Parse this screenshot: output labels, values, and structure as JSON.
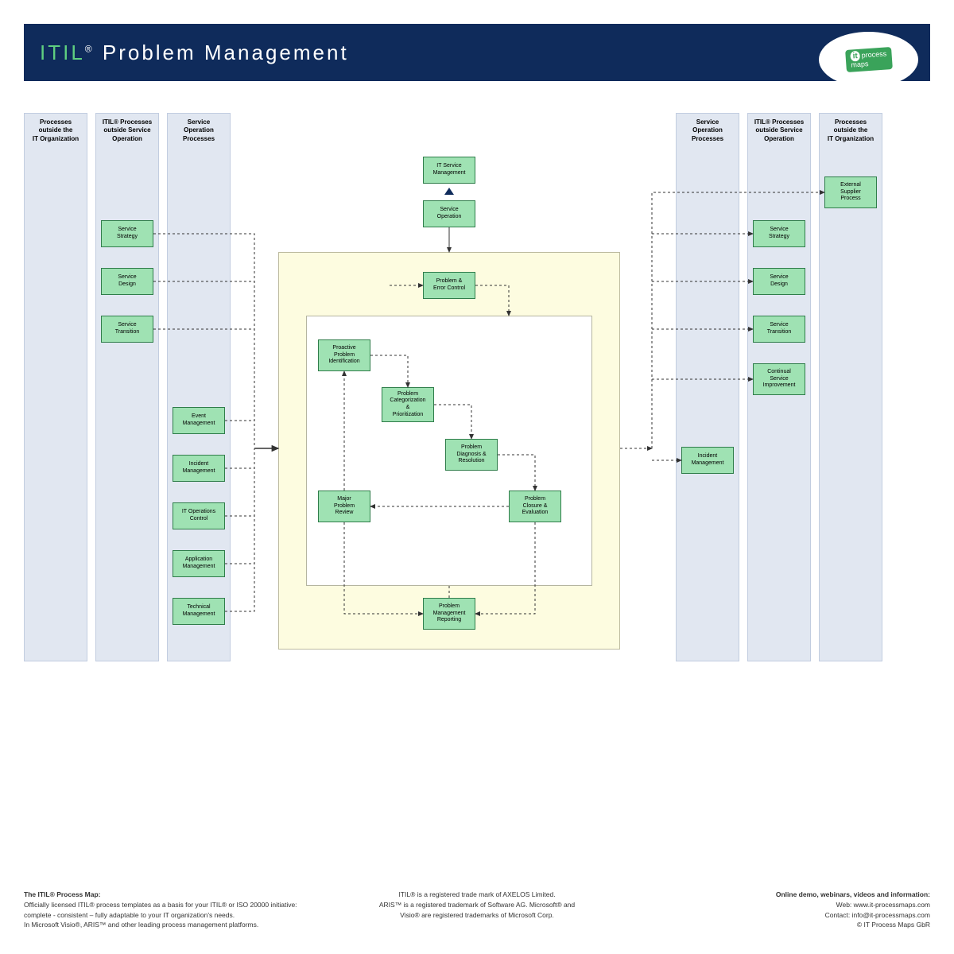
{
  "title": {
    "itil": "ITIL",
    "reg": "®",
    "rest": " Problem Management"
  },
  "badge": {
    "it": "it",
    "pm": "process\nmaps"
  },
  "lanes": {
    "l1": "Processes\noutside the\nIT Organization",
    "l2": "ITIL® Processes\noutside Service\nOperation",
    "l3": "Service\nOperation\nProcesses",
    "r1": "Service\nOperation\nProcesses",
    "r2": "ITIL® Processes\noutside Service\nOperation",
    "r3": "Processes\noutside the\nIT Organization"
  },
  "nodes": {
    "l2_ss": "Service\nStrategy",
    "l2_sd": "Service\nDesign",
    "l2_st": "Service\nTransition",
    "l3_em": "Event\nManagement",
    "l3_im": "Incident\nManagement",
    "l3_io": "IT Operations\nControl",
    "l3_am": "Application\nManagement",
    "l3_tm": "Technical\nManagement",
    "top_itsm": "IT Service\nManagement",
    "top_so": "Service\nOperation",
    "c_pec": "Problem &\nError Control",
    "c_ppi": "Proactive\nProblem\nIdentification",
    "c_pcp": "Problem\nCategorization\n&\nPrioritization",
    "c_pdr": "Problem\nDiagnosis &\nResolution",
    "c_pce": "Problem\nClosure &\nEvaluation",
    "c_mpr": "Major\nProblem\nReview",
    "c_pmr": "Problem\nManagement\nReporting",
    "r1_im": "Incident\nManagement",
    "r2_ss": "Service\nStrategy",
    "r2_sd": "Service\nDesign",
    "r2_st": "Service\nTransition",
    "r2_csi": "Continual\nService\nImprovement",
    "r3_esp": "External\nSupplier\nProcess"
  },
  "footer": {
    "l_h": "The ITIL® Process Map:",
    "l_1": "Officially licensed ITIL® process templates as a basis for your ITIL® or ISO 20000 initiative:",
    "l_2": "complete - consistent – fully adaptable to your IT organization's needs.",
    "l_3": "In Microsoft Visio®, ARIS™ and other leading process management platforms.",
    "c_1": "ITIL® is a registered trade mark of AXELOS Limited.",
    "c_2": "ARIS™ is a  registered trademark of Software AG. Microsoft® and",
    "c_3": "Visio® are registered trademarks of Microsoft Corp.",
    "r_h": "Online demo, webinars, videos and information:",
    "r_1": "Web: www.it-processmaps.com",
    "r_2": "Contact: info@it-processmaps.com",
    "r_3": "© IT Process Maps GbR"
  }
}
